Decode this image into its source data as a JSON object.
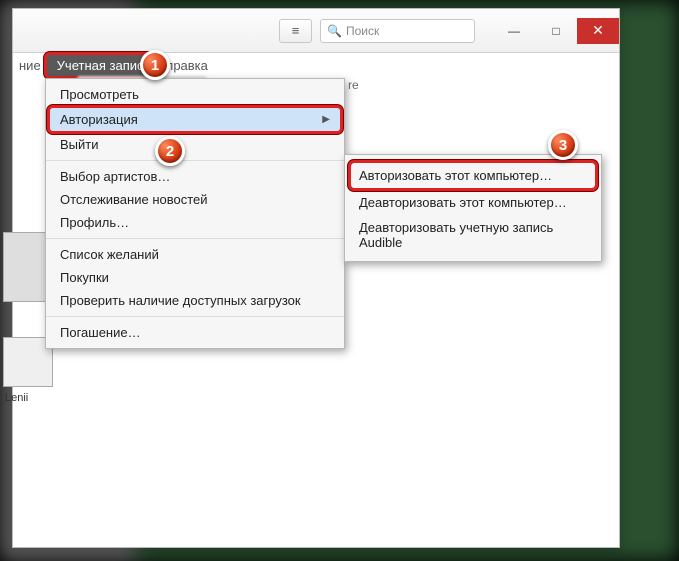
{
  "window": {
    "search_placeholder": "Поиск",
    "list_icon": "≡",
    "min": "—",
    "max": "□",
    "close": "✕"
  },
  "menubar": {
    "left_cut": "ние",
    "account": "Учетная запись",
    "help_cut": "правка"
  },
  "content": {
    "re": "re",
    "caption": "Lenii"
  },
  "menu": {
    "items": [
      "Просмотреть",
      "Авторизация",
      "Выйти",
      "Выбор артистов…",
      "Отслеживание новостей",
      "Профиль…",
      "Список желаний",
      "Покупки",
      "Проверить наличие доступных загрузок",
      "Погашение…"
    ]
  },
  "submenu": {
    "items": [
      "Авторизовать этот компьютер…",
      "Деавторизовать этот компьютер…",
      "Деавторизовать учетную запись Audible"
    ]
  },
  "badges": {
    "b1": "1",
    "b2": "2",
    "b3": "3"
  }
}
